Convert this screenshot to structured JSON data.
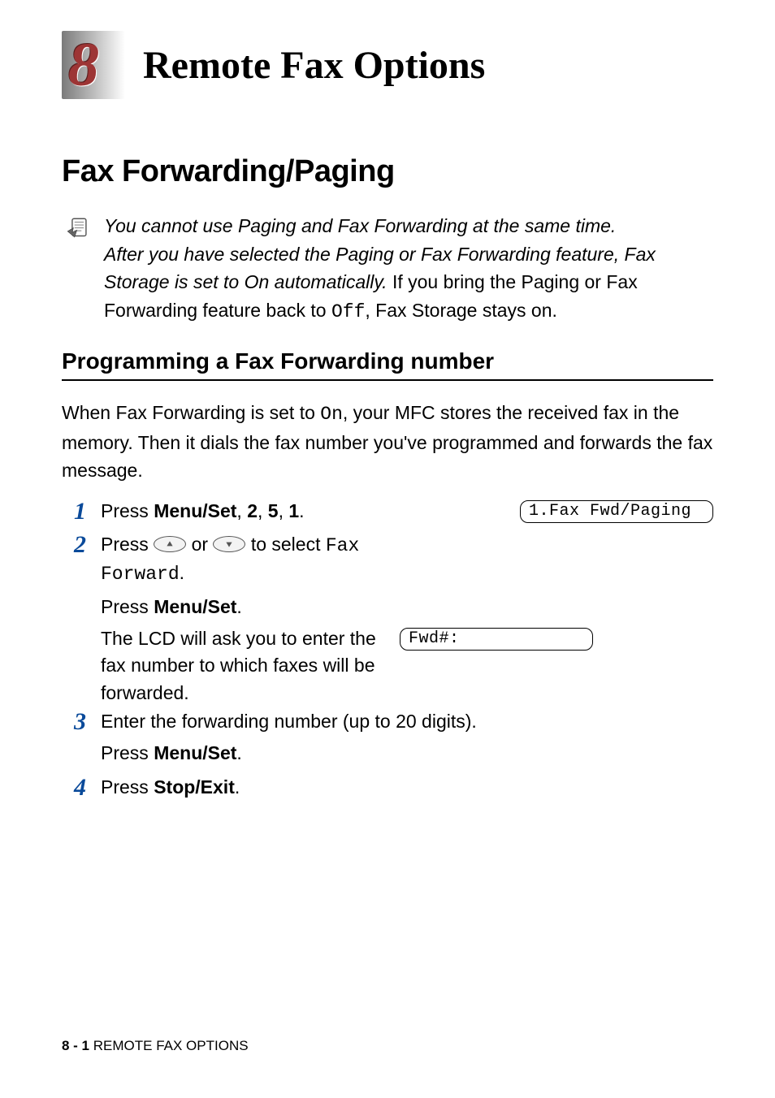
{
  "chapter": {
    "number": "8",
    "title": "Remote Fax Options"
  },
  "section1": {
    "heading": "Fax Forwarding/Paging"
  },
  "note": {
    "line1_italic": "You cannot use Paging and Fax Forwarding at the same time.",
    "line2_italic_a": "After you have selected the Paging or Fax Forwarding feature, Fax Storage is set to On automatically.",
    "line2_roman": " If you bring the Paging or Fax Forwarding feature back to ",
    "off_mono": "Off",
    "line2_tail": ", Fax Storage stays on."
  },
  "section2": {
    "heading": "Programming a Fax Forwarding number",
    "intro_a": "When Fax Forwarding is set to ",
    "intro_on": "On",
    "intro_b": ", your MFC stores the received fax in the memory. Then it dials the fax number you've programmed and forwards the fax message."
  },
  "steps": {
    "s1": {
      "num": "1",
      "press": "Press ",
      "menuset": "Menu/Set",
      "c1": ", ",
      "k2": "2",
      "c2": ", ",
      "k5": "5",
      "c3": ", ",
      "k1": "1",
      "dot": ".",
      "lcd": "1.Fax Fwd/Paging"
    },
    "s2": {
      "num": "2",
      "press": "Press ",
      "or": " or ",
      "to_select": " to select ",
      "fax": "Fax",
      "forward": "Forward",
      "dot": ".",
      "press2": "Press ",
      "menuset": "Menu/Set",
      "dot2": ".",
      "lcd_intro": "The LCD will ask you to enter the fax number to which faxes will be forwarded.",
      "lcd": "Fwd#:"
    },
    "s3": {
      "num": "3",
      "line1": "Enter the forwarding number (up to 20 digits).",
      "press": "Press ",
      "menuset": "Menu/Set",
      "dot": "."
    },
    "s4": {
      "num": "4",
      "press": "Press ",
      "stopexit": "Stop/Exit",
      "dot": "."
    }
  },
  "footer": {
    "page": "8 - 1",
    "sep": "   ",
    "label": "REMOTE FAX OPTIONS"
  }
}
